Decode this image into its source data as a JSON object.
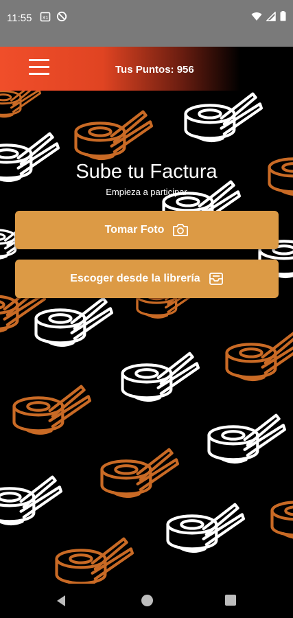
{
  "status_bar": {
    "time": "11:55",
    "icons": [
      "calendar-notification-icon",
      "do-not-disturb-icon",
      "wifi-icon",
      "signal-icon",
      "battery-icon"
    ]
  },
  "app_bar": {
    "points_label": "Tus Puntos: 956",
    "menu_icon": "hamburger-menu-icon",
    "gradient_colors": [
      "#f04e2a",
      "#000000"
    ]
  },
  "main": {
    "title": "Sube tu Factura",
    "subtitle": "Empieza a participar",
    "take_photo_label": "Tomar Foto",
    "take_photo_icon": "camera-icon",
    "library_label": "Escoger desde la librería",
    "library_icon": "inbox-tray-icon"
  },
  "background": {
    "pattern_icon": "sushi-chopsticks-icon",
    "pattern_colors": [
      "#ffffff",
      "#c96a25"
    ]
  },
  "colors": {
    "button": "#dc9a45",
    "background": "#000000",
    "status_bar": "#7a7a7a"
  },
  "nav_bar": {
    "icons": [
      "back-icon",
      "home-icon",
      "recents-icon"
    ]
  }
}
